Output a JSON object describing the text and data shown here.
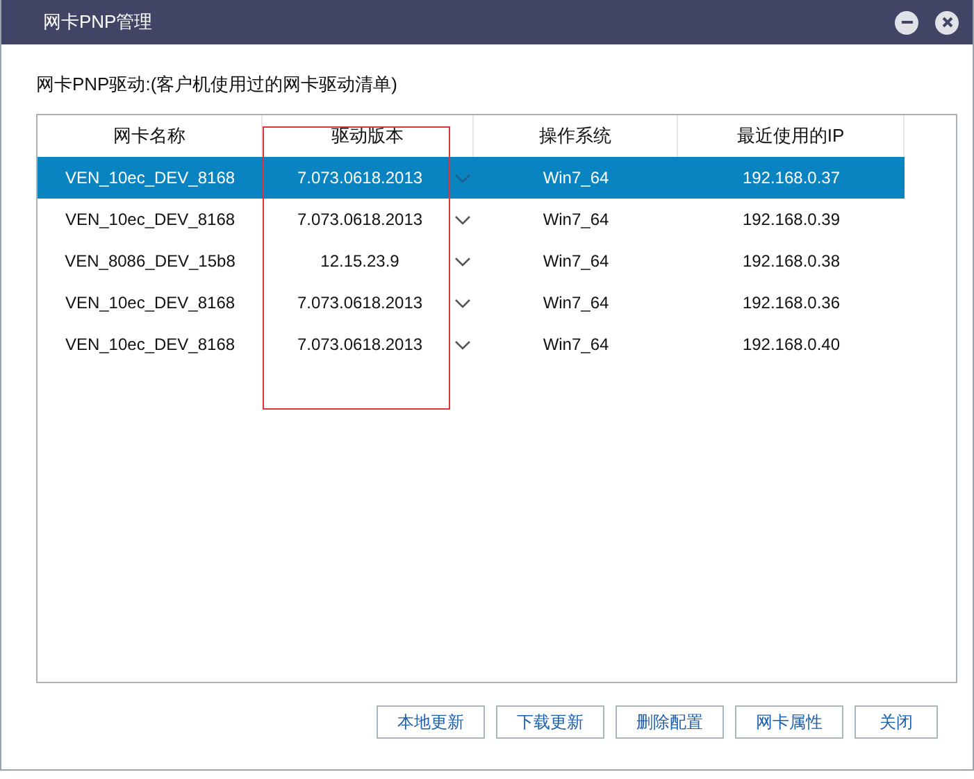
{
  "window": {
    "title": "网卡PNP管理"
  },
  "caption": "网卡PNP驱动:(客户机使用过的网卡驱动清单)",
  "table": {
    "columns": [
      {
        "label": "网卡名称",
        "highlighted": false
      },
      {
        "label": "驱动版本",
        "highlighted": true
      },
      {
        "label": "操作系统",
        "highlighted": false
      },
      {
        "label": "最近使用的IP",
        "highlighted": false
      }
    ],
    "rows": [
      {
        "name": "VEN_10ec_DEV_8168",
        "version": "7.073.0618.2013",
        "os": "Win7_64",
        "ip": "192.168.0.37",
        "selected": true
      },
      {
        "name": "VEN_10ec_DEV_8168",
        "version": "7.073.0618.2013",
        "os": "Win7_64",
        "ip": "192.168.0.39",
        "selected": false
      },
      {
        "name": "VEN_8086_DEV_15b8",
        "version": "12.15.23.9",
        "os": "Win7_64",
        "ip": "192.168.0.38",
        "selected": false
      },
      {
        "name": "VEN_10ec_DEV_8168",
        "version": "7.073.0618.2013",
        "os": "Win7_64",
        "ip": "192.168.0.36",
        "selected": false
      },
      {
        "name": "VEN_10ec_DEV_8168",
        "version": "7.073.0618.2013",
        "os": "Win7_64",
        "ip": "192.168.0.40",
        "selected": false
      }
    ]
  },
  "buttons": [
    "本地更新",
    "下载更新",
    "删除配置",
    "网卡属性",
    "关闭"
  ]
}
